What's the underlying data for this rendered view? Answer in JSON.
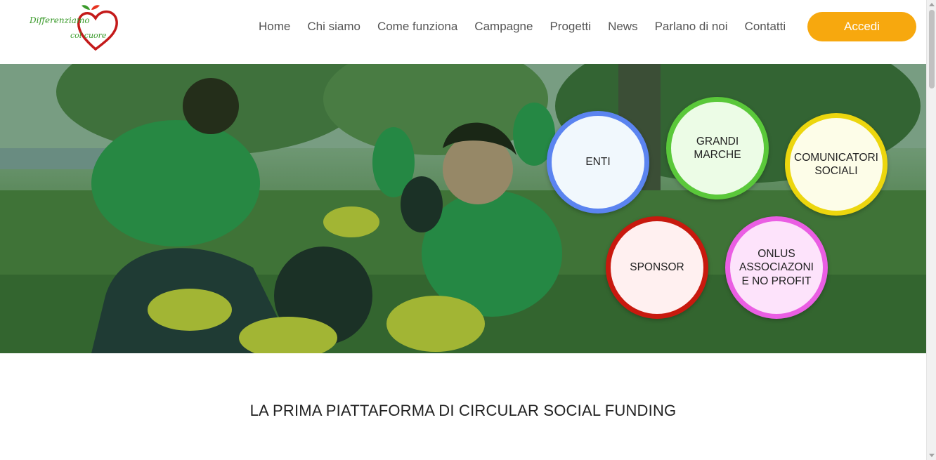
{
  "logo": {
    "line1": "Differenziamo",
    "line2": "col cuore"
  },
  "nav": {
    "items": [
      {
        "label": "Home"
      },
      {
        "label": "Chi siamo"
      },
      {
        "label": "Come funziona"
      },
      {
        "label": "Campagne"
      },
      {
        "label": "Progetti"
      },
      {
        "label": "News"
      },
      {
        "label": "Parlano di noi"
      },
      {
        "label": "Contatti"
      }
    ],
    "cta_label": "Accedi"
  },
  "hero": {
    "circles": [
      {
        "label": "ENTI",
        "border": "#5b84f0"
      },
      {
        "label": "GRANDI\nMARCHE",
        "border": "#5ac83a"
      },
      {
        "label": "COMUNICATORI\nSOCIALI",
        "border": "#ecd60e"
      },
      {
        "label": "SPONSOR",
        "border": "#c8190e"
      },
      {
        "label": "ONLUS\nASSOCIAZONI\nE NO PROFIT",
        "border": "#ea5ee3"
      }
    ]
  },
  "main": {
    "tagline": "LA PRIMA PIATTAFORMA DI CIRCULAR SOCIAL FUNDING"
  },
  "colors": {
    "accent": "#f7a80e",
    "logo_green": "#3a9a2a",
    "logo_red": "#c41a1a"
  }
}
